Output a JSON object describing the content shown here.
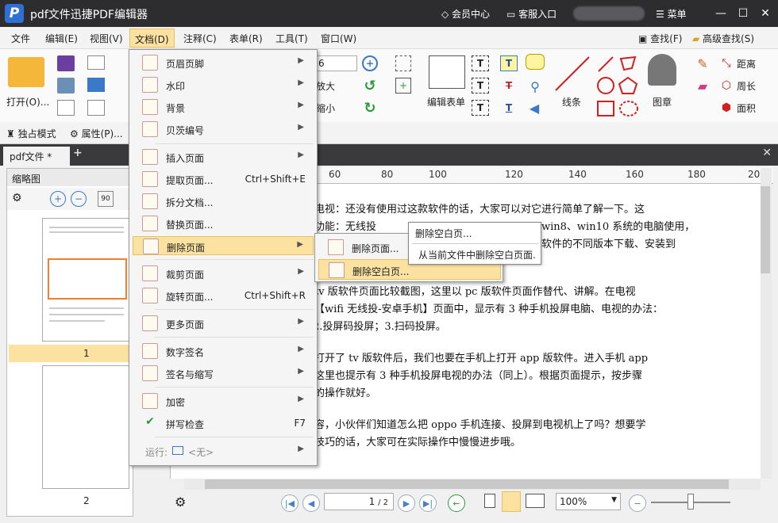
{
  "titlebar": {
    "title": "pdf文件迅捷PDF编辑器",
    "member": "会员中心",
    "service": "客服入口",
    "menu": "菜单"
  },
  "menubar": {
    "items": [
      "文件",
      "编辑(E)",
      "视图(V)",
      "文档(D)",
      "注释(C)",
      "表单(R)",
      "工具(T)",
      "窗口(W)"
    ],
    "find": "查找(F)",
    "adv_find": "高级查找(S)"
  },
  "ribbon": {
    "open": "打开(O)...",
    "font_size": "6",
    "zoom_in": "放大",
    "zoom_out": "缩小",
    "edit_form": "编辑表单",
    "line": "线条",
    "stamp": "图章",
    "distance": "距离",
    "perimeter": "周长",
    "area": "面积"
  },
  "subbar": {
    "exclusive": "独占模式",
    "props": "属性(P)..."
  },
  "tab": {
    "label": "pdf文件 *"
  },
  "sidebar": {
    "title": "缩略图",
    "page1": "1",
    "page2": "2"
  },
  "ruler": {
    "ticks": [
      "60",
      "80",
      "100",
      "120",
      "140",
      "160",
      "180",
      "20"
    ]
  },
  "document": {
    "lines": [
      "机、电视：还没有使用过这款软件的话，大家可以对它进行简单了解一下。这",
      "投屏功能：无线投",
      "win8、win10 系统的电脑使用，",
      "软件的不同版本下载、安装到",
      "件：tv 版软件页面比较截图，这里以 pc 版软件页面作替代、讲解。在电视",
      "，在【wifi 无线投-安卓手机】页面中，显示有 3 种手机投屏电脑、电视的办法：",
      "2.投屏码投屏；3.扫码投屏。",
      "件：打开了 tv 版软件后，我们也要在手机上打开 app 版软件。进入手机 app",
      "面，这里也提示有 3 种手机投屏电视的办法（同上）。根据页面提示，按步骤",
      "电视的操作就好。",
      "享内容，小伙伴们知道怎么把 oppo 手机连接、投屏到电视机上了吗？想要学",
      "投屏技巧的话，大家可在实际操作中慢慢进步哦。"
    ]
  },
  "doc_menu": {
    "header_footer": "页眉页脚",
    "watermark": "水印",
    "background": "背景",
    "bates": "贝茨编号",
    "insert": "插入页面",
    "extract": "提取页面...",
    "extract_sc": "Ctrl+Shift+E",
    "split": "拆分文档...",
    "replace": "替换页面...",
    "delete": "删除页面",
    "crop": "裁剪页面",
    "rotate": "旋转页面...",
    "rotate_sc": "Ctrl+Shift+R",
    "more": "更多页面",
    "digital_sign": "数字签名",
    "sign": "签名与缩写",
    "encrypt": "加密",
    "spell": "拼写检查",
    "spell_sc": "F7",
    "run": "运行:",
    "run_val": "<无>"
  },
  "sub_menu": {
    "delete_pages": "删除页面...",
    "delete_blank": "删除空白页..."
  },
  "tooltip": {
    "title": "删除空白页...",
    "desc": "从当前文件中删除空白页面."
  },
  "status": {
    "page": "1",
    "page_total": "/ 2",
    "zoom": "100%"
  }
}
